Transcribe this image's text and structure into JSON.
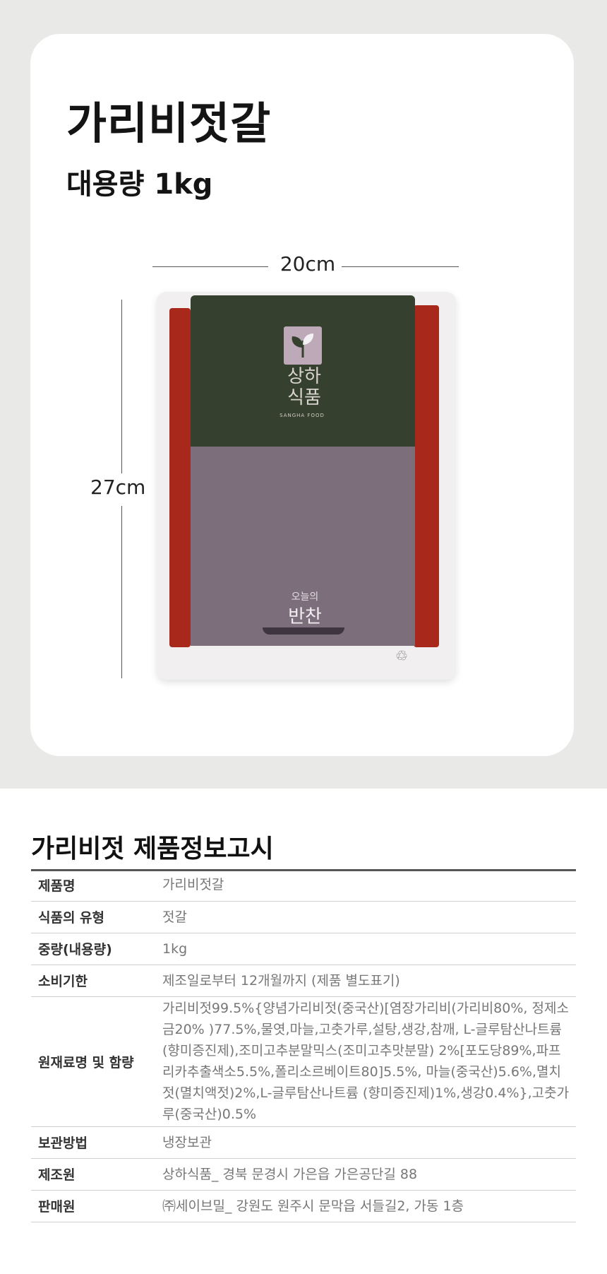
{
  "product": {
    "title": "가리비젓갈",
    "subtitle": "대용량 1kg"
  },
  "dimensions": {
    "width_label": "20cm",
    "height_label": "27cm"
  },
  "package": {
    "brand_line1": "상하",
    "brand_line2": "식품",
    "brand_en": "SANGHA FOOD",
    "tagline_small": "오늘의",
    "tagline_main": "반찬"
  },
  "info": {
    "title": "가리비젓 제품정보고시",
    "rows": [
      {
        "key": "제품명",
        "value": "가리비젓갈"
      },
      {
        "key": "식품의 유형",
        "value": "젓갈"
      },
      {
        "key": "중량(내용량)",
        "value": "1kg"
      },
      {
        "key": "소비기한",
        "value": "제조일로부터 12개월까지 (제품 별도표기)"
      },
      {
        "key": "원재료명 및 함량",
        "value": "가리비젓99.5%{양념가리비젓(중국산)[염장가리비(가리비80%, 정제소금20% )77.5%,물엿,마늘,고춧가루,설탕,생강,참깨, L-글루탐산나트륨(향미증진제),조미고추분말믹스(조미고추맛분말) 2%[포도당89%,파프리카추출색소5.5%,폴리소르베이트80]5.5%, 마늘(중국산)5.6%,멸치젓(멸치액젓)2%,L-글루탐산나트륨 (향미증진제)1%,생강0.4%},고춧가루(중국산)0.5%"
      },
      {
        "key": "보관방법",
        "value": "냉장보관"
      },
      {
        "key": "제조원",
        "value": "상하식품_ 경북 문경시 가은읍 가은공단길 88"
      },
      {
        "key": "판매원",
        "value": "㈜세이브밀_ 강원도 원주시 문막읍 서들길2, 가동 1층"
      }
    ]
  }
}
